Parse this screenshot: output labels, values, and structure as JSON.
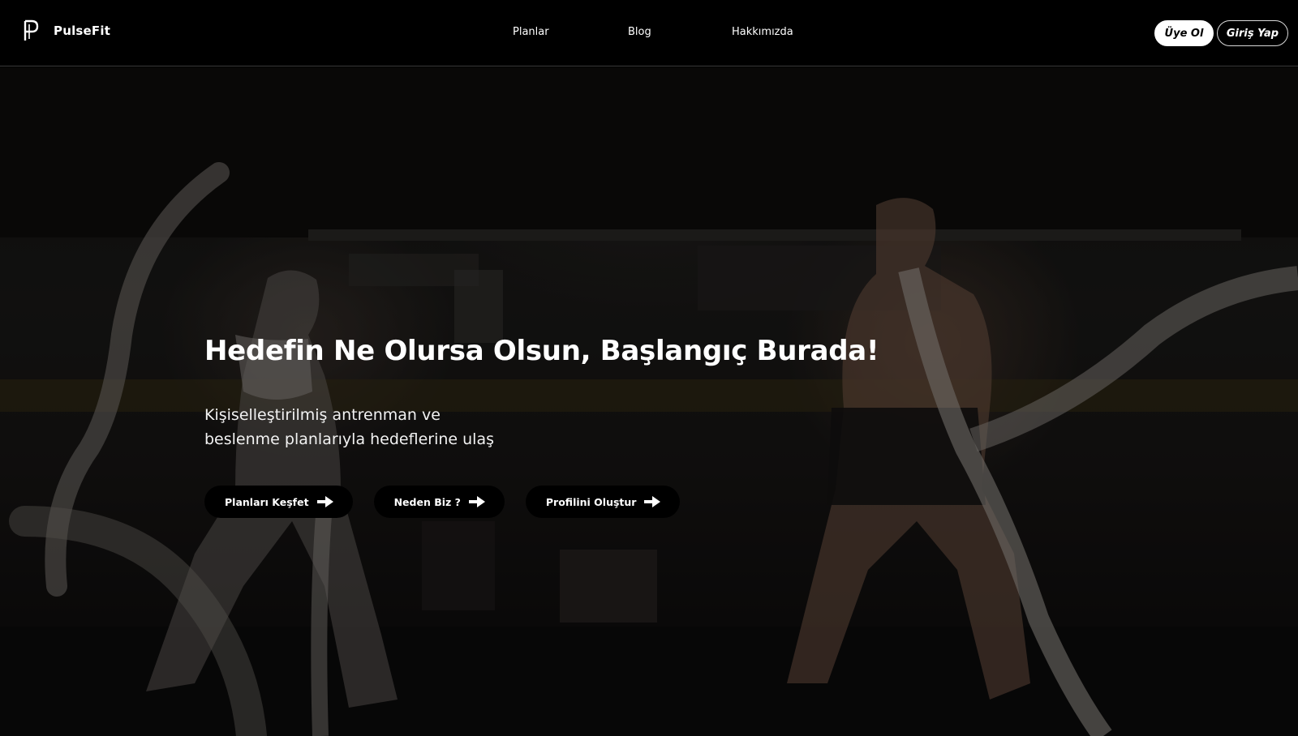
{
  "brand": {
    "logo_letter": "P",
    "name": "PulseFit"
  },
  "nav": {
    "items": [
      {
        "label": "Planlar"
      },
      {
        "label": "Blog"
      },
      {
        "label": "Hakkımızda"
      }
    ]
  },
  "auth": {
    "signup_label": "Üye Ol",
    "login_label": "Giriş Yap"
  },
  "hero": {
    "title": "Hedefin Ne Olursa Olsun, Başlangıç Burada!",
    "subtitle": "Kişiselleştirilmiş antrenman ve beslenme planlarıyla hedeflerine ulaş",
    "ctas": [
      {
        "label": "Planları Keşfet",
        "icon": "arrow-right-icon"
      },
      {
        "label": "Neden Biz ?",
        "icon": "arrow-right-icon"
      },
      {
        "label": "Profilini Oluştur",
        "icon": "arrow-right-icon"
      }
    ],
    "background_image": "dark gym photo, two athletes with battle ropes"
  },
  "colors": {
    "background": "#000000",
    "text": "#ffffff",
    "button_dark": "#000000",
    "button_light": "#ffffff"
  }
}
